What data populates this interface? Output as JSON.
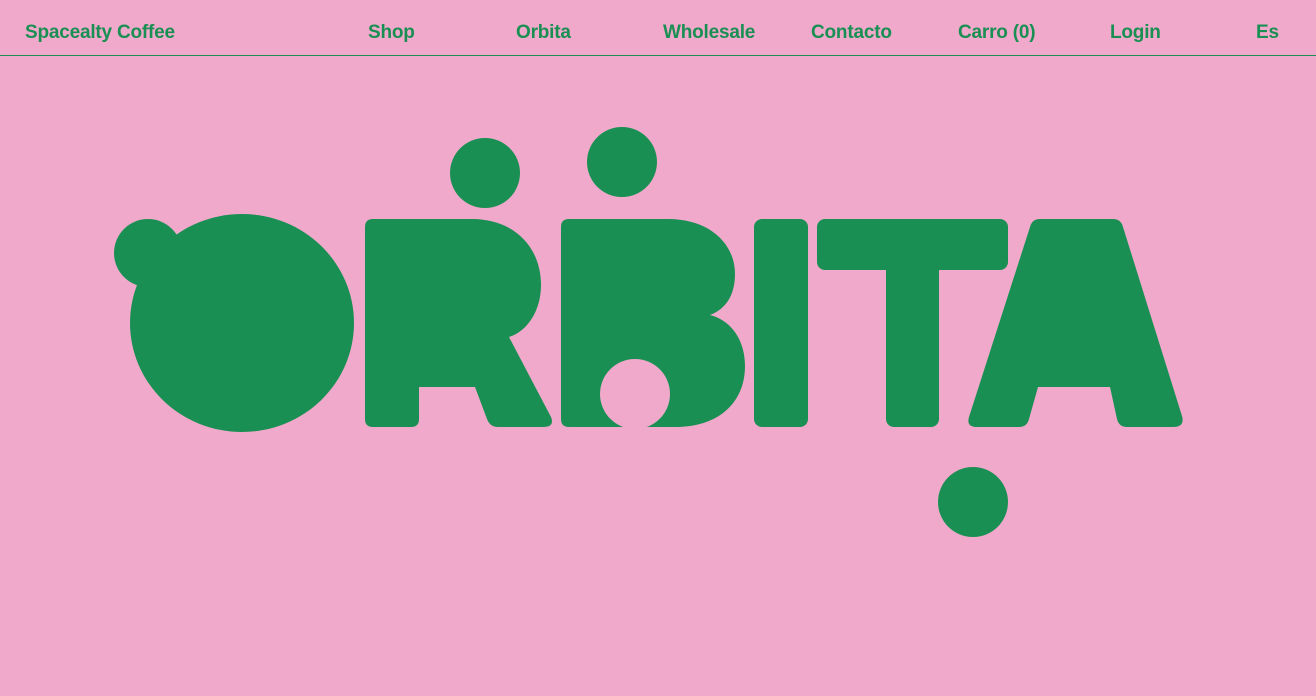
{
  "theme": {
    "background": "#f0a9cb",
    "accent": "#1a8f53"
  },
  "header": {
    "brand": "Spacealty Coffee",
    "nav": {
      "shop": "Shop",
      "orbita": "Orbita",
      "wholesale": "Wholesale",
      "contacto": "Contacto",
      "cart": "Carro (0)",
      "login": "Login",
      "language": "Es"
    }
  },
  "hero": {
    "logo_text": "ORBITA"
  }
}
